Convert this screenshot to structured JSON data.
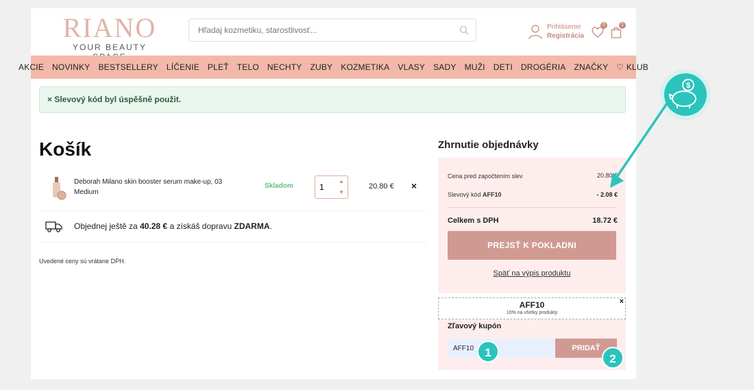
{
  "header": {
    "logo_main": "RIANO",
    "logo_sub": "YOUR BEAUTY SPACE",
    "search_placeholder": "Hľadaj kozmetiku, starostlivosť...",
    "login_label": "Prihlásenie",
    "register_label": "Registrácia",
    "wishlist_count": "0",
    "cart_count": "1"
  },
  "nav": {
    "items": [
      "AKCIE",
      "NOVINKY",
      "BESTSELLERY",
      "LÍČENIE",
      "PLEŤ",
      "TELO",
      "NECHTY",
      "ZUBY",
      "KOZMETIKA",
      "VLASY",
      "SADY",
      "MUŽI",
      "DETI",
      "DROGÉRIA",
      "ZNAČKY",
      "♡ KLUB"
    ]
  },
  "alert": {
    "text": "× Slevový kód byl úspěšně použit."
  },
  "cart": {
    "title": "Košík",
    "item": {
      "name": "Deborah Milano skin booster serum make-up, 03 Medium",
      "stock": "Skladom",
      "qty": "1",
      "price": "20.80 €",
      "remove": "×"
    },
    "shipping": {
      "prefix": "Objednej ještě za ",
      "amount": "40.28 €",
      "middle": " a získáš dopravu ",
      "free": "ZDARMA",
      "suffix": "."
    },
    "vat_note": "Uvedené ceny sú vrátane DPH."
  },
  "summary": {
    "title": "Zhrnutie objednávky",
    "price_before_label": "Cena pred započtením slev",
    "price_before_value": "20.80 €",
    "discount_label_prefix": "Slevový kód ",
    "discount_code": "AFF10",
    "discount_value": "- 2.08 €",
    "total_label": "Celkem s DPH",
    "total_value": "18.72 €",
    "checkout_label": "PREJSŤ K POKLADNI",
    "back_label": "Späť na výpis produktu"
  },
  "coupon": {
    "applied_code": "AFF10",
    "applied_desc": "10% na všetky produkty",
    "remove": "×",
    "title": "Zľavový kupón",
    "input_value": "AFF10",
    "button_label": "PRIDAŤ"
  },
  "callouts": {
    "one": "1",
    "two": "2"
  },
  "colors": {
    "accent_pink": "#f2b9aa",
    "button_rose": "#d09a93",
    "teal": "#2ac4bc",
    "stock_green": "#5cc27a"
  }
}
